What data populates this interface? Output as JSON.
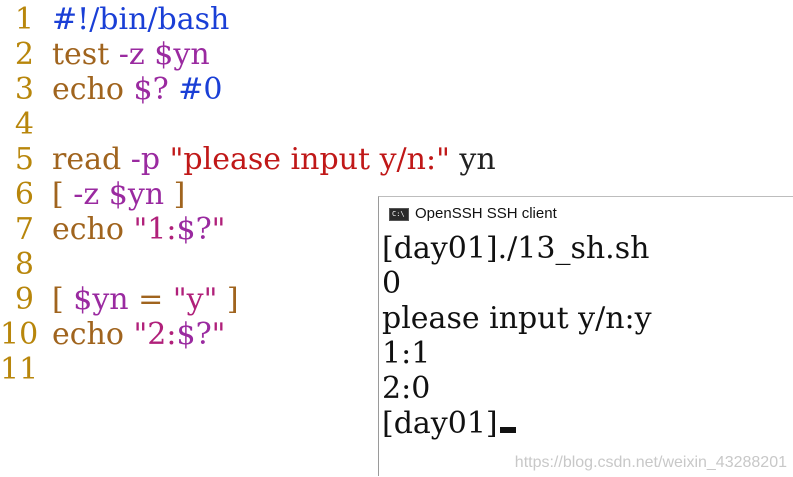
{
  "editor": {
    "lines": [
      {
        "num": "1",
        "parts": [
          {
            "text": "#!/bin/bash",
            "color": "blue"
          }
        ]
      },
      {
        "num": "2",
        "parts": [
          {
            "text": "test ",
            "color": "brown"
          },
          {
            "text": "-z ",
            "color": "purple"
          },
          {
            "text": "$yn",
            "color": "purple"
          }
        ]
      },
      {
        "num": "3",
        "parts": [
          {
            "text": "echo ",
            "color": "brown"
          },
          {
            "text": "$? ",
            "color": "purple"
          },
          {
            "text": "#0",
            "color": "blue"
          }
        ]
      },
      {
        "num": "4",
        "parts": []
      },
      {
        "num": "5",
        "parts": [
          {
            "text": "read ",
            "color": "brown"
          },
          {
            "text": "-p ",
            "color": "purple"
          },
          {
            "text": "\"please input y/n:\"",
            "color": "red"
          },
          {
            "text": " yn",
            "color": "dark"
          }
        ]
      },
      {
        "num": "6",
        "parts": [
          {
            "text": "[ ",
            "color": "brown"
          },
          {
            "text": "-z ",
            "color": "purple"
          },
          {
            "text": "$yn",
            "color": "purple"
          },
          {
            "text": " ]",
            "color": "brown"
          }
        ]
      },
      {
        "num": "7",
        "parts": [
          {
            "text": "echo ",
            "color": "brown"
          },
          {
            "text": "\"1:",
            "color": "magenta"
          },
          {
            "text": "$?",
            "color": "purple"
          },
          {
            "text": "\"",
            "color": "magenta"
          }
        ]
      },
      {
        "num": "8",
        "parts": []
      },
      {
        "num": "9",
        "parts": [
          {
            "text": "[ ",
            "color": "brown"
          },
          {
            "text": "$yn",
            "color": "purple"
          },
          {
            "text": " = ",
            "color": "brown"
          },
          {
            "text": "\"y\"",
            "color": "magenta"
          },
          {
            "text": " ]",
            "color": "brown"
          }
        ]
      },
      {
        "num": "10",
        "parts": [
          {
            "text": "echo ",
            "color": "brown"
          },
          {
            "text": "\"2:",
            "color": "magenta"
          },
          {
            "text": "$?",
            "color": "purple"
          },
          {
            "text": "\"",
            "color": "magenta"
          }
        ]
      },
      {
        "num": "11",
        "parts": []
      }
    ]
  },
  "terminal": {
    "icon_text": "C:\\",
    "title": "OpenSSH SSH client",
    "lines": [
      "[day01]./13_sh.sh",
      "0",
      "please input y/n:y",
      "1:1",
      "2:0",
      "[day01]"
    ]
  },
  "watermark": "https://blog.csdn.net/weixin_43288201",
  "colors": {
    "blue": "#1a3fd6",
    "brown": "#a0641e",
    "purple": "#9a2aa0",
    "magenta": "#b0207a",
    "red": "#c01818",
    "dark": "#222222",
    "line_number": "#b8860b"
  }
}
